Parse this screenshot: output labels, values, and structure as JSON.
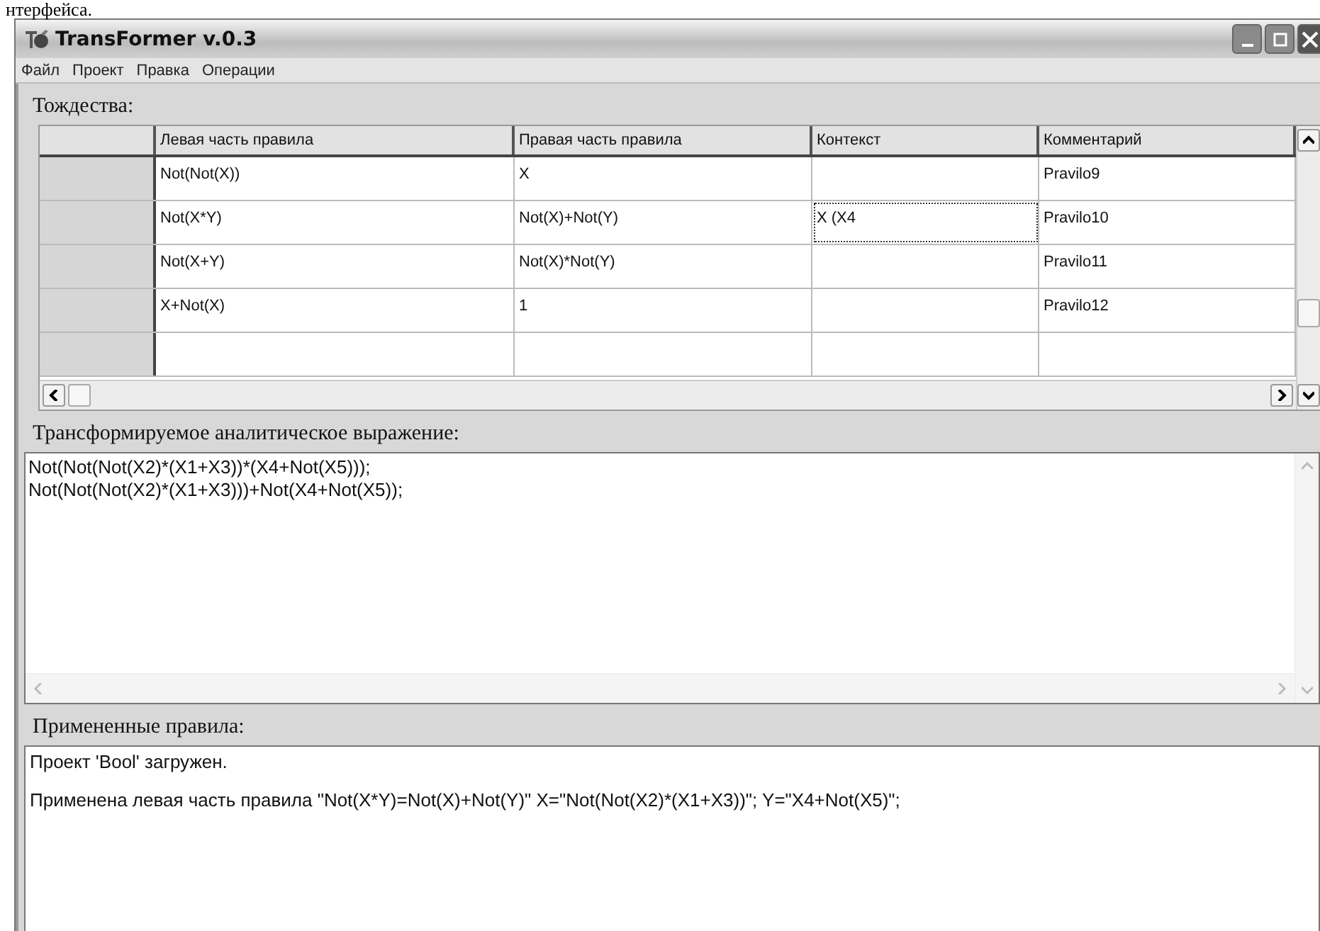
{
  "page_caption": "нтерфейса.",
  "window": {
    "title": "TransFormer v.0.3"
  },
  "menu": [
    "Файл",
    "Проект",
    "Правка",
    "Операции"
  ],
  "identities": {
    "label": "Тождества:",
    "columns": [
      "Левая часть правила",
      "Правая часть правила",
      "Контекст",
      "Комментарий"
    ],
    "rows": [
      {
        "cells": [
          "Not(Not(X))",
          "X",
          "",
          "Pravilo9"
        ],
        "context_focused": false
      },
      {
        "cells": [
          "Not(X*Y)",
          "Not(X)+Not(Y)",
          "X (X4",
          "Pravilo10"
        ],
        "context_focused": true
      },
      {
        "cells": [
          "Not(X+Y)",
          "Not(X)*Not(Y)",
          "",
          "Pravilo11"
        ],
        "context_focused": false
      },
      {
        "cells": [
          "X+Not(X)",
          "1",
          "",
          "Pravilo12"
        ],
        "context_focused": false
      },
      {
        "cells": [
          "",
          "",
          "",
          ""
        ],
        "context_focused": false
      }
    ]
  },
  "expression": {
    "label": "Трансформируемое аналитическое выражение:",
    "lines": [
      "Not(Not(Not(X2)*(X1+X3))*(X4+Not(X5)));",
      "Not(Not(Not(X2)*(X1+X3)))+Not(X4+Not(X5));"
    ]
  },
  "applied": {
    "label": "Примененные правила:",
    "lines": [
      "Проект 'Bool' загружен.",
      "Применена левая часть правила \"Not(X*Y)=Not(X)+Not(Y)\"    X=\"Not(Not(X2)*(X1+X3))\"; Y=\"X4+Not(X5)\";"
    ]
  }
}
